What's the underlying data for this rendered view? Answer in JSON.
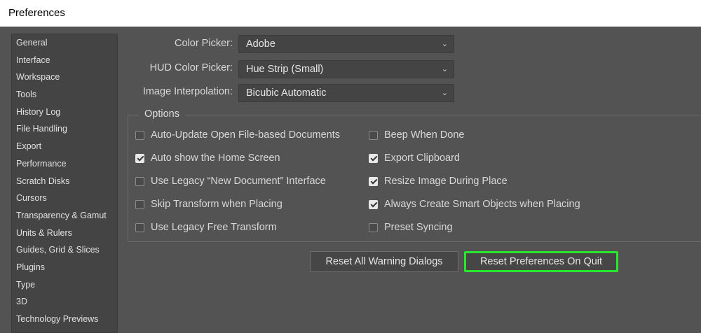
{
  "window": {
    "title": "Preferences"
  },
  "sidebar": {
    "items": [
      {
        "label": "General",
        "active": true
      },
      {
        "label": "Interface"
      },
      {
        "label": "Workspace"
      },
      {
        "label": "Tools"
      },
      {
        "label": "History Log"
      },
      {
        "label": "File Handling"
      },
      {
        "label": "Export"
      },
      {
        "label": "Performance"
      },
      {
        "label": "Scratch Disks"
      },
      {
        "label": "Cursors"
      },
      {
        "label": "Transparency & Gamut"
      },
      {
        "label": "Units & Rulers"
      },
      {
        "label": "Guides, Grid & Slices"
      },
      {
        "label": "Plugins"
      },
      {
        "label": "Type"
      },
      {
        "label": "3D"
      },
      {
        "label": "Technology Previews"
      }
    ]
  },
  "general": {
    "color_picker": {
      "label": "Color Picker:",
      "value": "Adobe"
    },
    "hud_color_picker": {
      "label": "HUD Color Picker:",
      "value": "Hue Strip (Small)"
    },
    "image_interpolation": {
      "label": "Image Interpolation:",
      "value": "Bicubic Automatic"
    }
  },
  "options": {
    "legend": "Options",
    "left": [
      {
        "label": "Auto-Update Open File-based Documents",
        "checked": false
      },
      {
        "label": "Auto show the Home Screen",
        "checked": true
      },
      {
        "label": "Use Legacy “New Document” Interface",
        "checked": false
      },
      {
        "label": "Skip Transform when Placing",
        "checked": false
      },
      {
        "label": "Use Legacy Free Transform",
        "checked": false
      }
    ],
    "right": [
      {
        "label": "Beep When Done",
        "checked": false
      },
      {
        "label": "Export Clipboard",
        "checked": true
      },
      {
        "label": "Resize Image During Place",
        "checked": true
      },
      {
        "label": "Always Create Smart Objects when Placing",
        "checked": true
      },
      {
        "label": "Preset Syncing",
        "checked": false
      }
    ]
  },
  "buttons": {
    "reset_warnings": "Reset All Warning Dialogs",
    "reset_prefs": "Reset Preferences On Quit"
  },
  "colors": {
    "highlight_outline": "#29e62e",
    "panel_bg": "#535353"
  }
}
